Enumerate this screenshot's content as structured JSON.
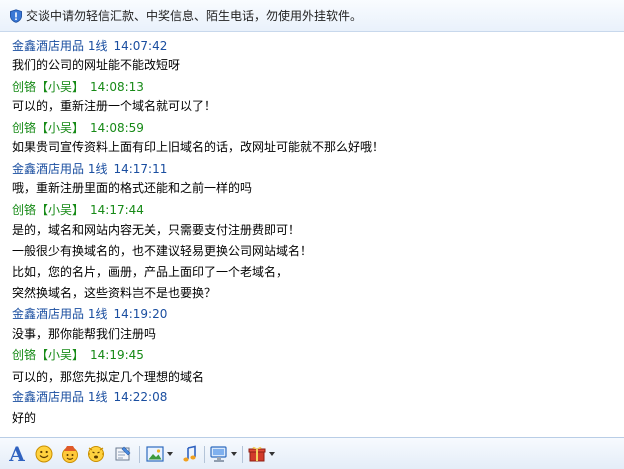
{
  "notice": {
    "icon": "shield-icon",
    "text": "交谈中请勿轻信汇款、中奖信息、陌生电话，勿使用外挂软件。"
  },
  "messages": [
    {
      "sender": "金鑫酒店用品 1线",
      "time": "14:07:42",
      "is_me": false,
      "lines": [
        "我们的公司的网址能不能改短呀"
      ]
    },
    {
      "sender": "创铬【小吴】",
      "time": "14:08:13",
      "is_me": true,
      "lines": [
        "可以的，重新注册一个域名就可以了！"
      ]
    },
    {
      "sender": "创铬【小吴】",
      "time": "14:08:59",
      "is_me": true,
      "lines": [
        "如果贵司宣传资料上面有印上旧域名的话，改网址可能就不那么好哦！"
      ]
    },
    {
      "sender": "金鑫酒店用品 1线",
      "time": "14:17:11",
      "is_me": false,
      "lines": [
        "哦，重新注册里面的格式还能和之前一样的吗"
      ]
    },
    {
      "sender": "创铬【小吴】",
      "time": "14:17:44",
      "is_me": true,
      "lines": [
        "是的，域名和网站内容无关，只需要支付注册费即可！",
        "一般很少有换域名的，也不建议轻易更换公司网站域名！",
        "比如，您的名片，画册，产品上面印了一个老域名，",
        "突然换域名，这些资料岂不是也要换？"
      ]
    },
    {
      "sender": "金鑫酒店用品 1线",
      "time": "14:19:20",
      "is_me": false,
      "lines": [
        "没事，那你能帮我们注册吗"
      ]
    },
    {
      "sender": "创铬【小吴】",
      "time": "14:19:45",
      "is_me": true,
      "lines": [
        "可以的，那您先拟定几个理想的域名"
      ]
    },
    {
      "sender": "金鑫酒店用品 1线",
      "time": "14:22:08",
      "is_me": false,
      "lines": [
        "好的"
      ]
    }
  ],
  "toolbar": {
    "buttons": [
      {
        "icon": "font-icon",
        "glyph": "A"
      },
      {
        "icon": "emoticon-icon"
      },
      {
        "icon": "magic-emoticon-icon"
      },
      {
        "icon": "nudge-icon"
      },
      {
        "icon": "voice-message-icon"
      },
      {
        "icon": "image-icon",
        "dropdown": true
      },
      {
        "icon": "music-icon"
      },
      {
        "icon": "screen-capture-icon",
        "dropdown": true
      },
      {
        "icon": "gift-icon",
        "dropdown": true
      }
    ]
  },
  "colors": {
    "sender": "#1a4ea0",
    "me": "#168a16",
    "message": "#000000",
    "accent": "#2f62c0"
  }
}
